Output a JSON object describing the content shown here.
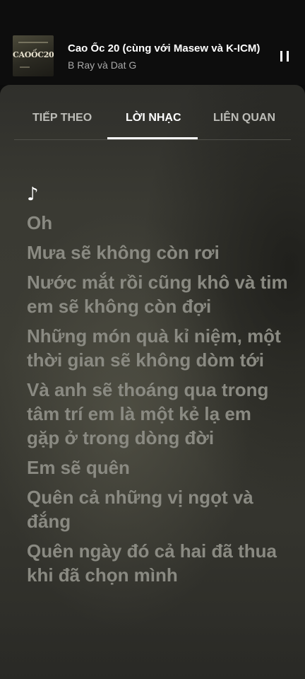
{
  "now_playing": {
    "album_art_text": "CAOỐC20",
    "title": "Cao Ốc 20 (cùng với Masew và K-ICM)",
    "artist": "B Ray và Dat G",
    "control": "pause-icon"
  },
  "tabs": [
    {
      "label": "TIẾP THEO",
      "selected": false
    },
    {
      "label": "LỜI NHẠC",
      "selected": true
    },
    {
      "label": "LIÊN QUAN",
      "selected": false
    }
  ],
  "lyrics": {
    "note_symbol": "♪",
    "lines": [
      "Oh",
      "Mưa sẽ không còn rơi",
      "Nước mắt rồi cũng khô và tim em sẽ không còn đợi",
      "Những món quà kỉ niệm, một thời gian sẽ không dòm tới",
      "Và anh sẽ thoáng qua trong tâm trí em là một kẻ lạ em gặp ở trong dòng đời",
      "Em sẽ quên",
      "Quên cả những vị ngọt và đắng",
      "Quên ngày đó cả hai đã thua khi đã chọn mình"
    ]
  },
  "colors": {
    "background": "#0b0b0b",
    "panel": "#3a3a33",
    "lyric_text": "#8a8a82",
    "active_tab": "#ffffff",
    "inactive_tab": "#bdbdb8"
  }
}
